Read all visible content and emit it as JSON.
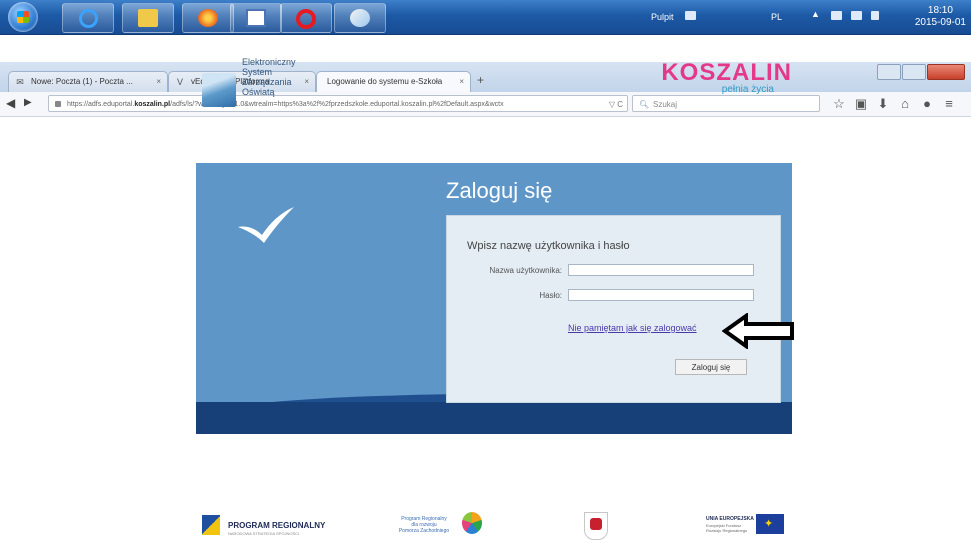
{
  "taskbar": {
    "apps": [
      {
        "name": "internet-explorer-icon"
      },
      {
        "name": "folder-icon"
      },
      {
        "name": "firefox-icon"
      },
      {
        "name": "word-icon"
      },
      {
        "name": "opera-icon"
      },
      {
        "name": "paint-icon"
      }
    ],
    "tray": {
      "desktop_label": "Pulpit",
      "lang": "PL",
      "time": "18:10",
      "date": "2015-09-01"
    }
  },
  "browser": {
    "tabs": [
      {
        "label": "Nowe: Poczta (1) - Poczta ...",
        "icon": "mail-icon",
        "active": false
      },
      {
        "label": "vEdukacja - Platforma",
        "icon": "v-icon",
        "active": false
      },
      {
        "label": "Logowanie do systemu e-Szkoła",
        "icon": "",
        "active": true
      }
    ],
    "new_tab": "+",
    "url_prefix": "https://adfs.eduportal.",
    "url_domain": "koszalin.pl",
    "url_rest": "/adfs/ls/?wa=wsignin1.0&wtrealm=https%3a%2f%2fprzedszkole.eduportal.koszalin.pl%2fDefault.aspx&wctx",
    "search_placeholder": "Szukaj"
  },
  "page": {
    "esz_logo_lines": [
      "Elektroniczny",
      "System",
      "Zarządzania",
      "Oświatą"
    ],
    "brand_name": "KOSZALIN",
    "brand_tagline": "pełnia życia",
    "login_title": "Zaloguj się",
    "card_heading": "Wpisz nazwę użytkownika i hasło",
    "username_label": "Nazwa użytkownika:",
    "password_label": "Hasło:",
    "username_value": "",
    "password_value": "",
    "forgot_link": "Nie pamiętam jak się zalogować",
    "login_button": "Zaloguj się"
  },
  "footer": {
    "program_regionalny": "PROGRAM REGIONALNY",
    "program_regionalny_sub": "NARODOWA STRATEGIA SPÓJNOŚCI",
    "pomorze_lines": [
      "Program Regionalny",
      "dla rozwoju",
      "Pomorza Zachodniego"
    ],
    "ue_title": "UNIA EUROPEJSKA",
    "ue_sub_lines": [
      "Europejski Fundusz",
      "Rozwoju Regionalnego"
    ]
  },
  "colors": {
    "panel_blue": "#5f96c8",
    "panel_dark": "#1f4f8f",
    "taskbar_blue": "#1d5aa6",
    "link_purple": "#4a3aa8"
  }
}
